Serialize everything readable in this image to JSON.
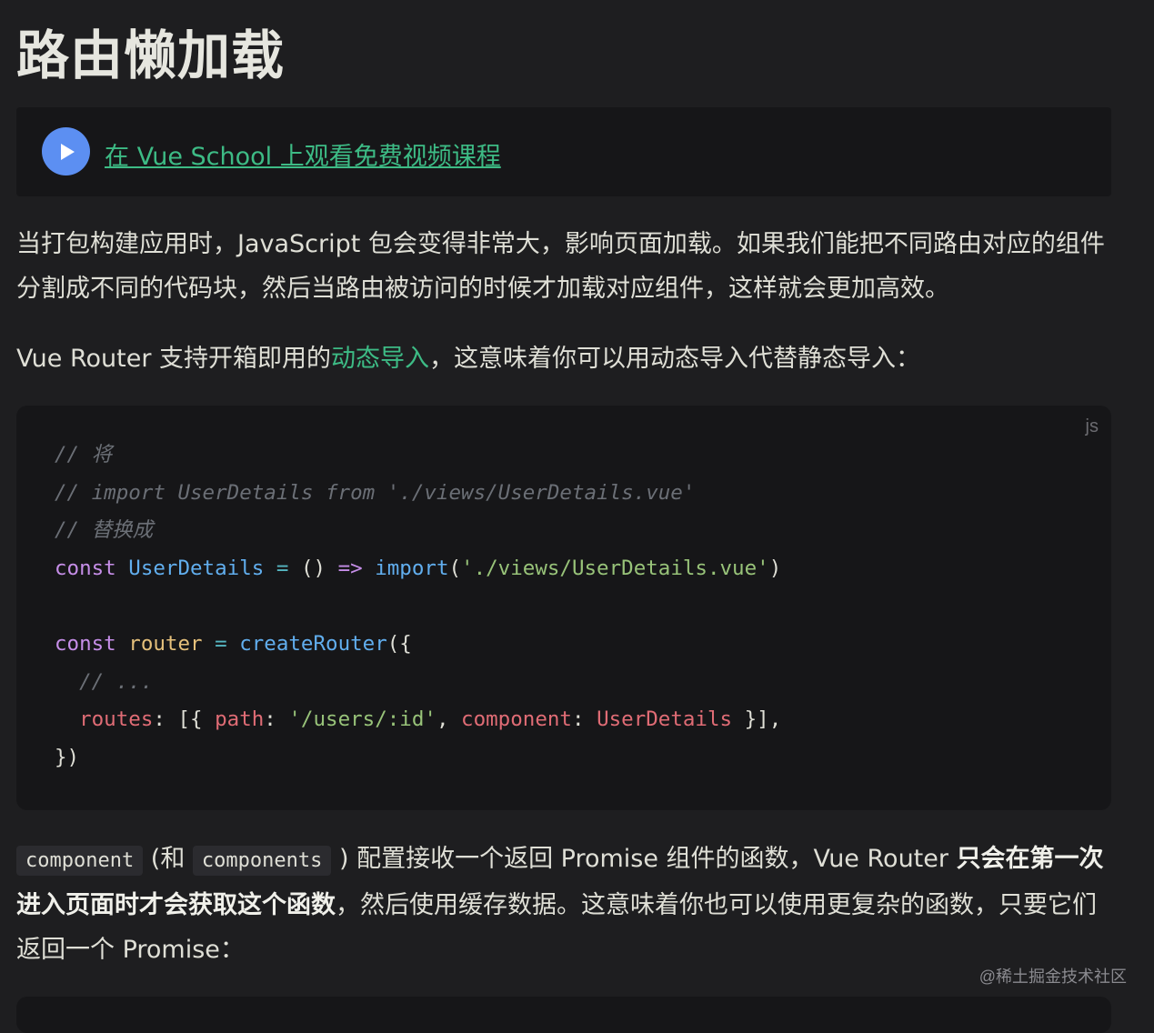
{
  "heading": "路由懒加载",
  "video": {
    "link_text": "在 Vue School 上观看免费视频课程"
  },
  "p1": "当打包构建应用时，JavaScript 包会变得非常大，影响页面加载。如果我们能把不同路由对应的组件分割成不同的代码块，然后当路由被访问的时候才加载对应组件，这样就会更加高效。",
  "p2": {
    "before": "Vue Router 支持开箱即用的",
    "link": "动态导入",
    "after": "，这意味着你可以用动态导入代替静态导入："
  },
  "code": {
    "lang": "js",
    "c1": "// 将",
    "c2": "// import UserDetails from './views/UserDetails.vue'",
    "c3": "// 替换成",
    "l4_const": "const",
    "l4_name": "UserDetails",
    "l4_eq": "=",
    "l4_paren": "()",
    "l4_arrow": "=>",
    "l4_import": "import",
    "l4_open": "(",
    "l4_str": "'./views/UserDetails.vue'",
    "l4_close": ")",
    "l6_const": "const",
    "l6_name": "router",
    "l6_eq": "=",
    "l6_fn": "createRouter",
    "l6_open": "({",
    "c7": "// ...",
    "l8_routes": "routes",
    "l8_colon1": ": [{ ",
    "l8_path": "path",
    "l8_colon2": ": ",
    "l8_str": "'/users/:id'",
    "l8_comma": ", ",
    "l8_component": "component",
    "l8_colon3": ": ",
    "l8_val": "UserDetails",
    "l8_end": " }],",
    "l9": "})"
  },
  "p3": {
    "code1": "component",
    "t1": " (和 ",
    "code2": "components",
    "t2": " ) 配置接收一个返回 Promise 组件的函数，Vue Router ",
    "bold": "只会在第一次进入页面时才会获取这个函数",
    "t3": "，然后使用缓存数据。这意味着你也可以使用更复杂的函数，只要它们返回一个 Promise："
  },
  "watermark": "@稀土掘金技术社区"
}
